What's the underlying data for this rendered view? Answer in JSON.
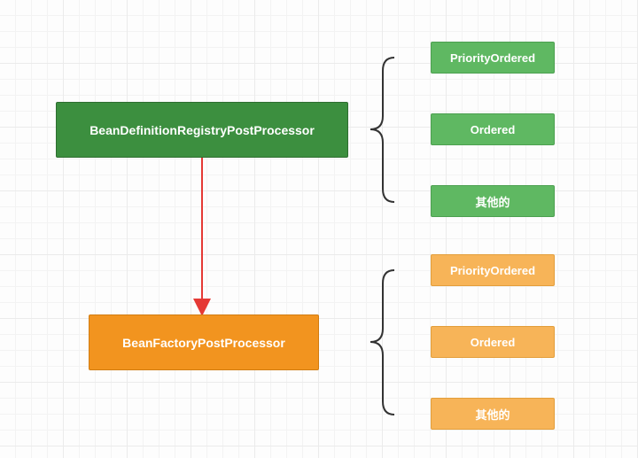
{
  "diagram": {
    "nodes": {
      "registry": "BeanDefinitionRegistryPostProcessor",
      "factory": "BeanFactoryPostProcessor",
      "green1": "PriorityOrdered",
      "green2": "Ordered",
      "green3": "其他的",
      "orange1": "PriorityOrdered",
      "orange2": "Ordered",
      "orange3": "其他的"
    }
  }
}
